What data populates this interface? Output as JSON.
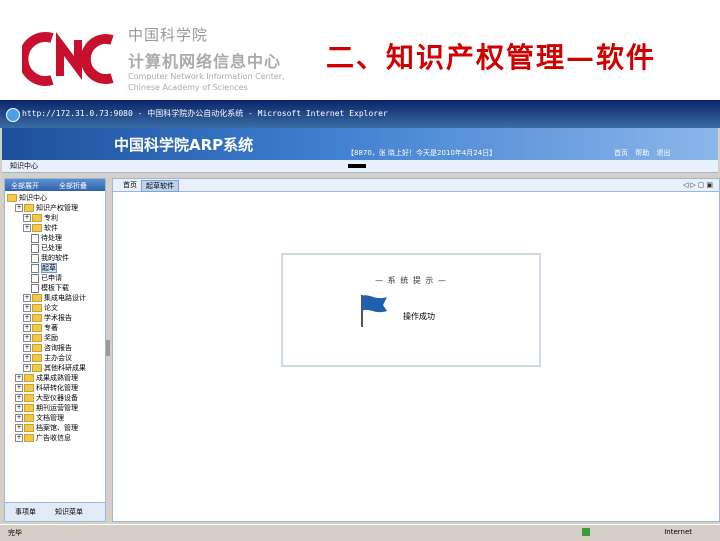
{
  "slide": {
    "org_cn": "中国科学院",
    "center_cn": "计算机网络信息中心",
    "center_en_line1": "Computer Network Information Center,",
    "center_en_line2": "Chinese Academy of Sciences",
    "title": "二、知识产权管理—软件",
    "title_color": "#d00000"
  },
  "browser": {
    "title": "http://172.31.0.73:9080 - 中国科学院办公自动化系统 - Microsoft Internet Explorer",
    "status_text": "完毕",
    "zone_text": "Internet"
  },
  "app": {
    "system_name": "中国科学院ARP系统",
    "user_info": "【8870，张  晓上好！今天是2010年4月24日】",
    "links": [
      "首页",
      "帮助",
      "退出"
    ],
    "nav_label": "知识中心",
    "left_tabs": [
      "全部展开",
      "全部折叠"
    ],
    "tree": [
      {
        "label": "知识中心",
        "level": 0,
        "kind": "root"
      },
      {
        "label": "知识产权管理",
        "level": 1,
        "kind": "folder"
      },
      {
        "label": "专利",
        "level": 2,
        "kind": "folder"
      },
      {
        "label": "软件",
        "level": 2,
        "kind": "folder"
      },
      {
        "label": "待处理",
        "level": 3,
        "kind": "doc"
      },
      {
        "label": "已处理",
        "level": 3,
        "kind": "doc"
      },
      {
        "label": "我的软件",
        "level": 3,
        "kind": "doc"
      },
      {
        "label": "起草",
        "level": 3,
        "kind": "doc",
        "selected": true
      },
      {
        "label": "已申请",
        "level": 3,
        "kind": "doc"
      },
      {
        "label": "模板下载",
        "level": 3,
        "kind": "doc"
      },
      {
        "label": "集成电路设计",
        "level": 2,
        "kind": "folder"
      },
      {
        "label": "论文",
        "level": 2,
        "kind": "folder"
      },
      {
        "label": "学术报告",
        "level": 2,
        "kind": "folder"
      },
      {
        "label": "专著",
        "level": 2,
        "kind": "folder"
      },
      {
        "label": "奖励",
        "level": 2,
        "kind": "folder"
      },
      {
        "label": "咨询报告",
        "level": 2,
        "kind": "folder"
      },
      {
        "label": "主办会议",
        "level": 2,
        "kind": "folder"
      },
      {
        "label": "其他科研成果",
        "level": 2,
        "kind": "folder"
      },
      {
        "label": "成果成熟管理",
        "level": 1,
        "kind": "folder"
      },
      {
        "label": "科研转化管理",
        "level": 1,
        "kind": "folder"
      },
      {
        "label": "大型仪器设备",
        "level": 1,
        "kind": "folder"
      },
      {
        "label": "期刊运营管理",
        "level": 1,
        "kind": "folder"
      },
      {
        "label": "文档管理",
        "level": 1,
        "kind": "folder"
      },
      {
        "label": "档案馆、管理",
        "level": 1,
        "kind": "folder"
      },
      {
        "label": "广告收信息",
        "level": 1,
        "kind": "folder"
      }
    ],
    "left_buttons": [
      "事项单",
      "知识菜单"
    ],
    "main_tabs": [
      "首页",
      "起草软件"
    ],
    "window_controls": "◁▷▢▣",
    "dialog": {
      "title": "— 系 统 提 示 —",
      "message": "操作成功"
    }
  }
}
